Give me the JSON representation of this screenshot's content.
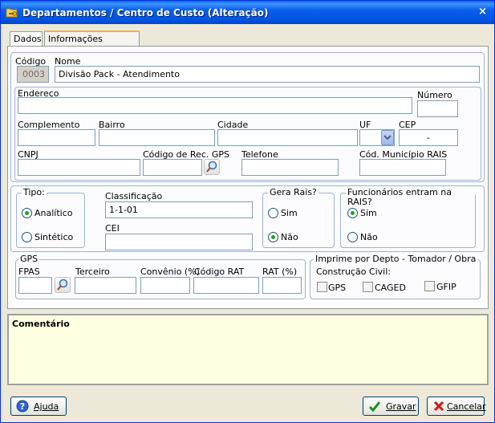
{
  "window": {
    "title": "Departamentos / Centro de Custo (Alteração)",
    "close_glyph": "×",
    "title_icon": "folder-key-icon"
  },
  "tabs": [
    {
      "label": "Dados",
      "active": false
    },
    {
      "label": "Informações Adicionais",
      "active": true
    }
  ],
  "fields": {
    "codigo_label": "Código",
    "codigo_value": "0003",
    "nome_label": "Nome",
    "nome_value": "Divisão Pack - Atendimento",
    "endereco_label": "Endereço",
    "endereco_value": "",
    "numero_label": "Número",
    "numero_value": "",
    "complemento_label": "Complemento",
    "complemento_value": "",
    "bairro_label": "Bairro",
    "bairro_value": "",
    "cidade_label": "Cidade",
    "cidade_value": "",
    "uf_label": "UF",
    "uf_value": "",
    "cep_label": "CEP",
    "cep_value": "-",
    "cnpj_label": "CNPJ",
    "cnpj_value": "",
    "codrec_label": "Código de Rec. GPS",
    "codrec_value": "",
    "telefone_label": "Telefone",
    "telefone_value": "",
    "codmun_label": "Cód. Município RAIS",
    "codmun_value": ""
  },
  "tipo": {
    "legend": "Tipo:",
    "options": [
      {
        "label": "Analítico",
        "selected": true
      },
      {
        "label": "Sintético",
        "selected": false
      }
    ]
  },
  "classificacao": {
    "label": "Classificação",
    "value": "1-1-01",
    "cei_label": "CEI",
    "cei_value": ""
  },
  "gera_rais": {
    "legend": "Gera Rais?",
    "options": [
      {
        "label": "Sim",
        "selected": false
      },
      {
        "label": "Não",
        "selected": true
      }
    ]
  },
  "funcionarios_rais": {
    "legend": "Funcionários entram na RAIS?",
    "options": [
      {
        "label": "Sim",
        "selected": true
      },
      {
        "label": "Não",
        "selected": false
      }
    ]
  },
  "gps": {
    "legend": "GPS",
    "fpas_label": "FPAS",
    "fpas_value": "",
    "terceiro_label": "Terceiro",
    "terceiro_value": "",
    "convenio_label": "Convênio (%)",
    "convenio_value": "",
    "codrat_label": "Código RAT",
    "codrat_value": "",
    "rat_label": "RAT (%)",
    "rat_value": ""
  },
  "imprime": {
    "legend": "Imprime por Depto - Tomador / Obra",
    "sublabel": "Construção Civil:",
    "options": [
      {
        "label": "GPS",
        "checked": false
      },
      {
        "label": "CAGED",
        "checked": false
      },
      {
        "label": "GFIP",
        "checked": false
      }
    ]
  },
  "comentario": {
    "label": "Comentário",
    "value": ""
  },
  "buttons": {
    "ajuda": "Ajuda",
    "gravar": "Gravar",
    "cancelar": "Cancelar"
  },
  "colors": {
    "titlebar": "#0054E3",
    "comment_bg": "#FFFFE1",
    "radio_dot": "#21A121",
    "active_tab_accent": "#F3B73C"
  }
}
